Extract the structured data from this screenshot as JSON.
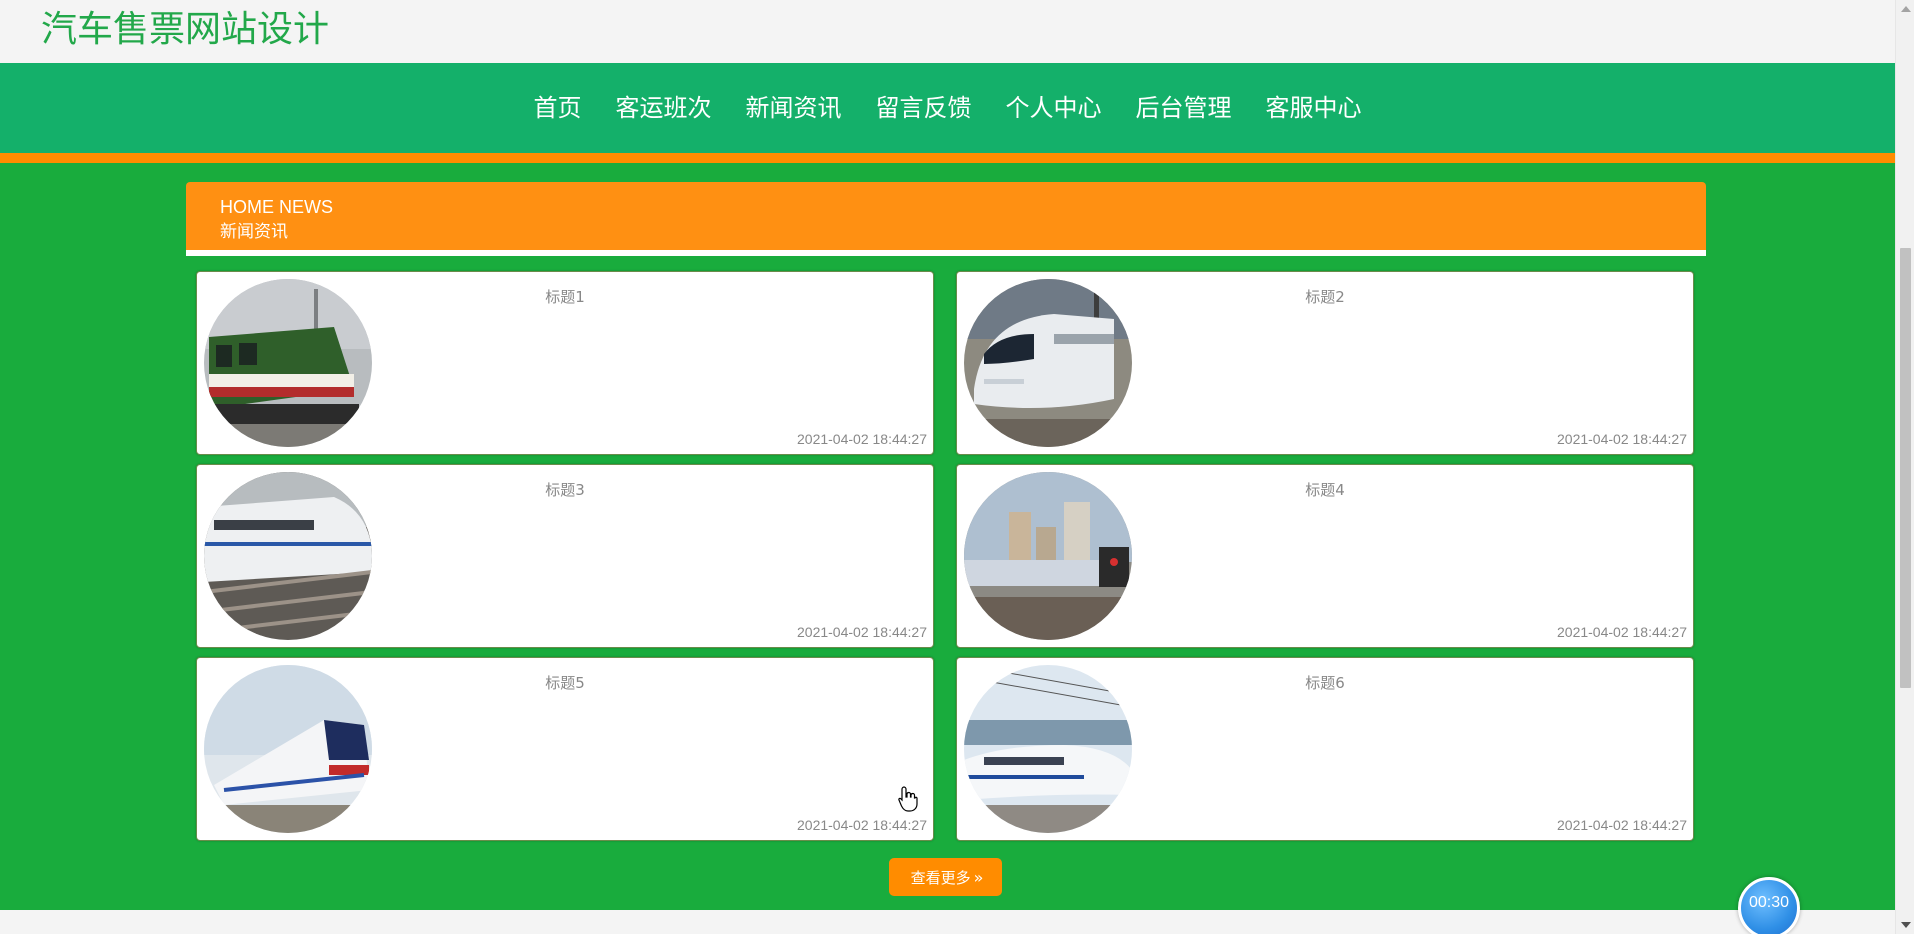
{
  "header": {
    "site_title": "汽车售票网站设计"
  },
  "nav": {
    "items": [
      {
        "label": "首页"
      },
      {
        "label": "客运班次"
      },
      {
        "label": "新闻资讯"
      },
      {
        "label": "留言反馈"
      },
      {
        "label": "个人中心"
      },
      {
        "label": "后台管理"
      },
      {
        "label": "客服中心"
      }
    ]
  },
  "news_section": {
    "heading_en": "HOME NEWS",
    "heading_cn": "新闻资讯",
    "items": [
      {
        "title": "标题1",
        "date": "2021-04-02 18:44:27",
        "image": "train-thumbnail"
      },
      {
        "title": "标题2",
        "date": "2021-04-02 18:44:27",
        "image": "train-thumbnail"
      },
      {
        "title": "标题3",
        "date": "2021-04-02 18:44:27",
        "image": "train-thumbnail"
      },
      {
        "title": "标题4",
        "date": "2021-04-02 18:44:27",
        "image": "train-thumbnail"
      },
      {
        "title": "标题5",
        "date": "2021-04-02 18:44:27",
        "image": "train-thumbnail"
      },
      {
        "title": "标题6",
        "date": "2021-04-02 18:44:27",
        "image": "train-thumbnail"
      }
    ],
    "more_label": "查看更多"
  },
  "timer": {
    "label": "00:30"
  },
  "colors": {
    "title_green": "#22a84a",
    "nav_green": "#14b06a",
    "main_green": "#19ac3d",
    "accent_orange": "#ff9012",
    "timer_blue": "#2f8fe6"
  }
}
